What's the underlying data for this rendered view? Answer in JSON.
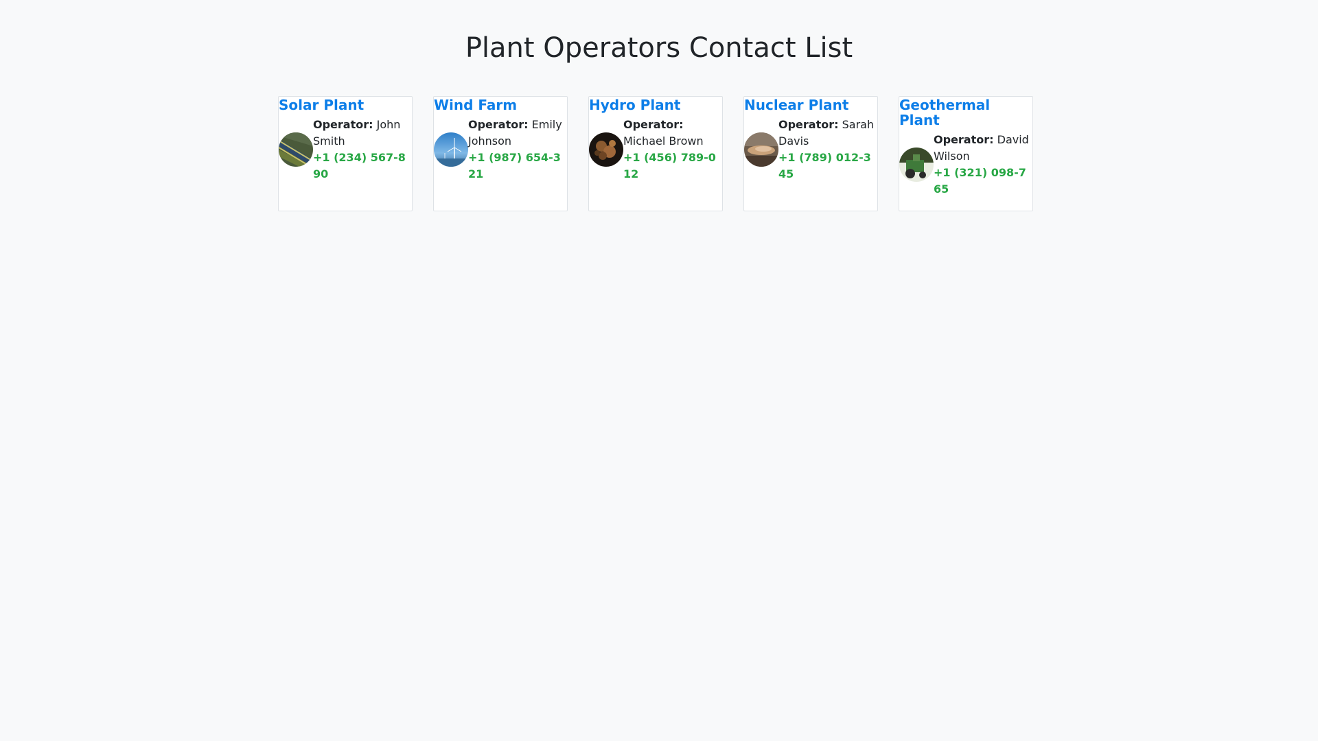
{
  "page": {
    "title": "Plant Operators Contact List"
  },
  "labels": {
    "operator": "Operator:"
  },
  "colors": {
    "background": "#f8f9fa",
    "card_title": "#0d7ee8",
    "phone": "#28a745",
    "text": "#212529"
  },
  "cards": [
    {
      "plant": "Solar Plant",
      "operator": "John Smith",
      "phone": "+1 (234) 567-890",
      "avatar_icon": "solar-panel-photo"
    },
    {
      "plant": "Wind Farm",
      "operator": "Emily Johnson",
      "phone": "+1 (987) 654-321",
      "avatar_icon": "wind-turbine-photo"
    },
    {
      "plant": "Hydro Plant",
      "operator": "Michael Brown",
      "phone": "+1 (456) 789-012",
      "avatar_icon": "hydro-plant-photo"
    },
    {
      "plant": "Nuclear Plant",
      "operator": "Sarah Davis",
      "phone": "+1 (789) 012-345",
      "avatar_icon": "nuclear-plant-photo"
    },
    {
      "plant": "Geothermal Plant",
      "operator": "David Wilson",
      "phone": "+1 (321) 098-765",
      "avatar_icon": "geothermal-plant-photo"
    }
  ]
}
